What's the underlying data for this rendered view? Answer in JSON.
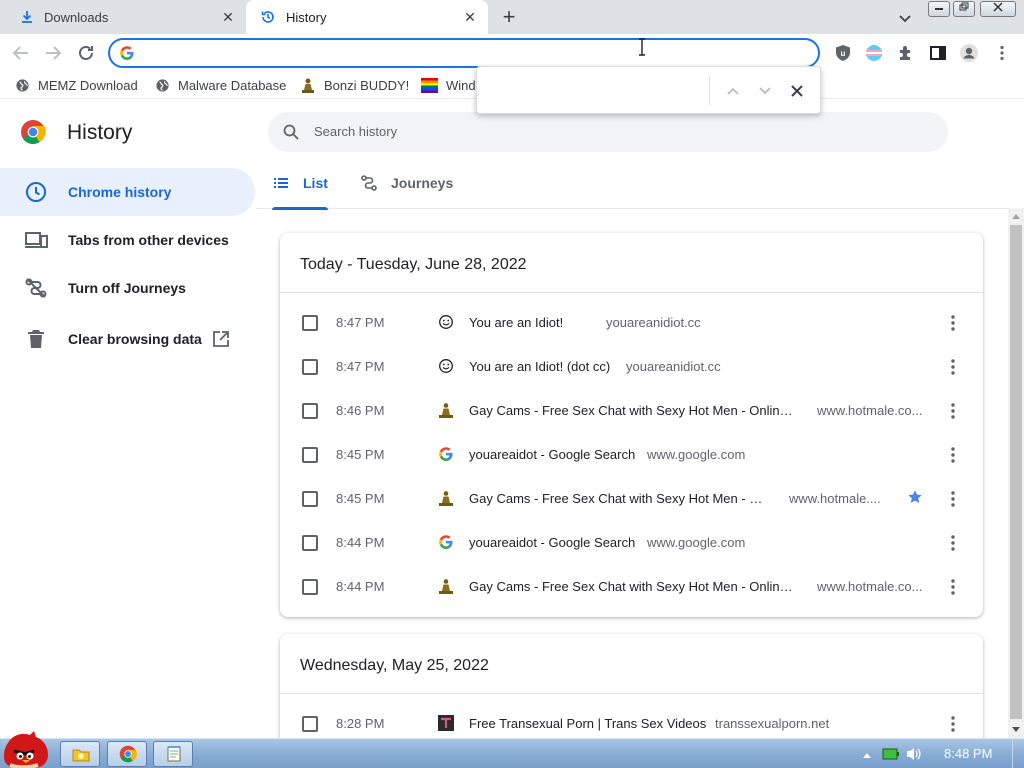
{
  "browser": {
    "tabs": [
      {
        "title": "Downloads",
        "icon": "download-icon",
        "active": false
      },
      {
        "title": "History",
        "icon": "history-icon",
        "active": true
      }
    ],
    "new_tab_glyph": "+",
    "close_glyph": "✕"
  },
  "bookmarks": [
    {
      "label": "MEMZ Download",
      "icon": "globe-icon"
    },
    {
      "label": "Malware Database",
      "icon": "globe-icon"
    },
    {
      "label": "Bonzi BUDDY!",
      "icon": "bonzi-icon"
    },
    {
      "label": "Wind",
      "icon": "windows-flag-icon"
    }
  ],
  "history": {
    "page_title": "History",
    "search_placeholder": "Search history",
    "sidebar": [
      {
        "label": "Chrome history",
        "icon": "clock-icon",
        "active": true
      },
      {
        "label": "Tabs from other devices",
        "icon": "devices-icon",
        "active": false
      },
      {
        "label": "Turn off Journeys",
        "icon": "journeys-off-icon",
        "active": false
      },
      {
        "label": "Clear browsing data",
        "icon": "trash-icon",
        "active": false
      }
    ],
    "tabs": [
      {
        "label": "List",
        "icon": "list-icon",
        "active": true
      },
      {
        "label": "Journeys",
        "icon": "journeys-icon",
        "active": false
      }
    ],
    "groups": [
      {
        "heading": "Today - Tuesday, June 28, 2022",
        "entries": [
          {
            "time": "8:47 PM",
            "title": "You are an Idiot!",
            "domain": "youareanidiot.cc",
            "favicon": "smiley",
            "starred": false
          },
          {
            "time": "8:47 PM",
            "title": "You are an Idiot! (dot cc)",
            "domain": "youareanidiot.cc",
            "favicon": "smiley",
            "starred": false
          },
          {
            "time": "8:46 PM",
            "title": "Gay Cams - Free Sex Chat with Sexy Hot Men - Online N...",
            "domain": "www.hotmale.co...",
            "favicon": "people",
            "starred": false
          },
          {
            "time": "8:45 PM",
            "title": "youareaidot - Google Search",
            "domain": "www.google.com",
            "favicon": "google",
            "starred": false
          },
          {
            "time": "8:45 PM",
            "title": "Gay Cams - Free Sex Chat with Sexy Hot Men - Onli...",
            "domain": "www.hotmale....",
            "favicon": "people",
            "starred": true
          },
          {
            "time": "8:44 PM",
            "title": "youareaidot - Google Search",
            "domain": "www.google.com",
            "favicon": "google",
            "starred": false
          },
          {
            "time": "8:44 PM",
            "title": "Gay Cams - Free Sex Chat with Sexy Hot Men - Online N...",
            "domain": "www.hotmale.co...",
            "favicon": "people",
            "starred": false
          }
        ]
      },
      {
        "heading": "Wednesday, May 25, 2022",
        "entries": [
          {
            "time": "8:28 PM",
            "title": "Free Transexual Porn | Trans Sex Videos",
            "domain": "transsexualporn.net",
            "favicon": "tsp",
            "starred": false
          }
        ]
      }
    ]
  },
  "taskbar": {
    "clock": "8:48 PM"
  },
  "colors": {
    "accent": "#1967d2",
    "sidebar_active_bg": "#e8f0fe",
    "tabstrip_bg": "#dee1e6",
    "star": "#4a86e8"
  }
}
